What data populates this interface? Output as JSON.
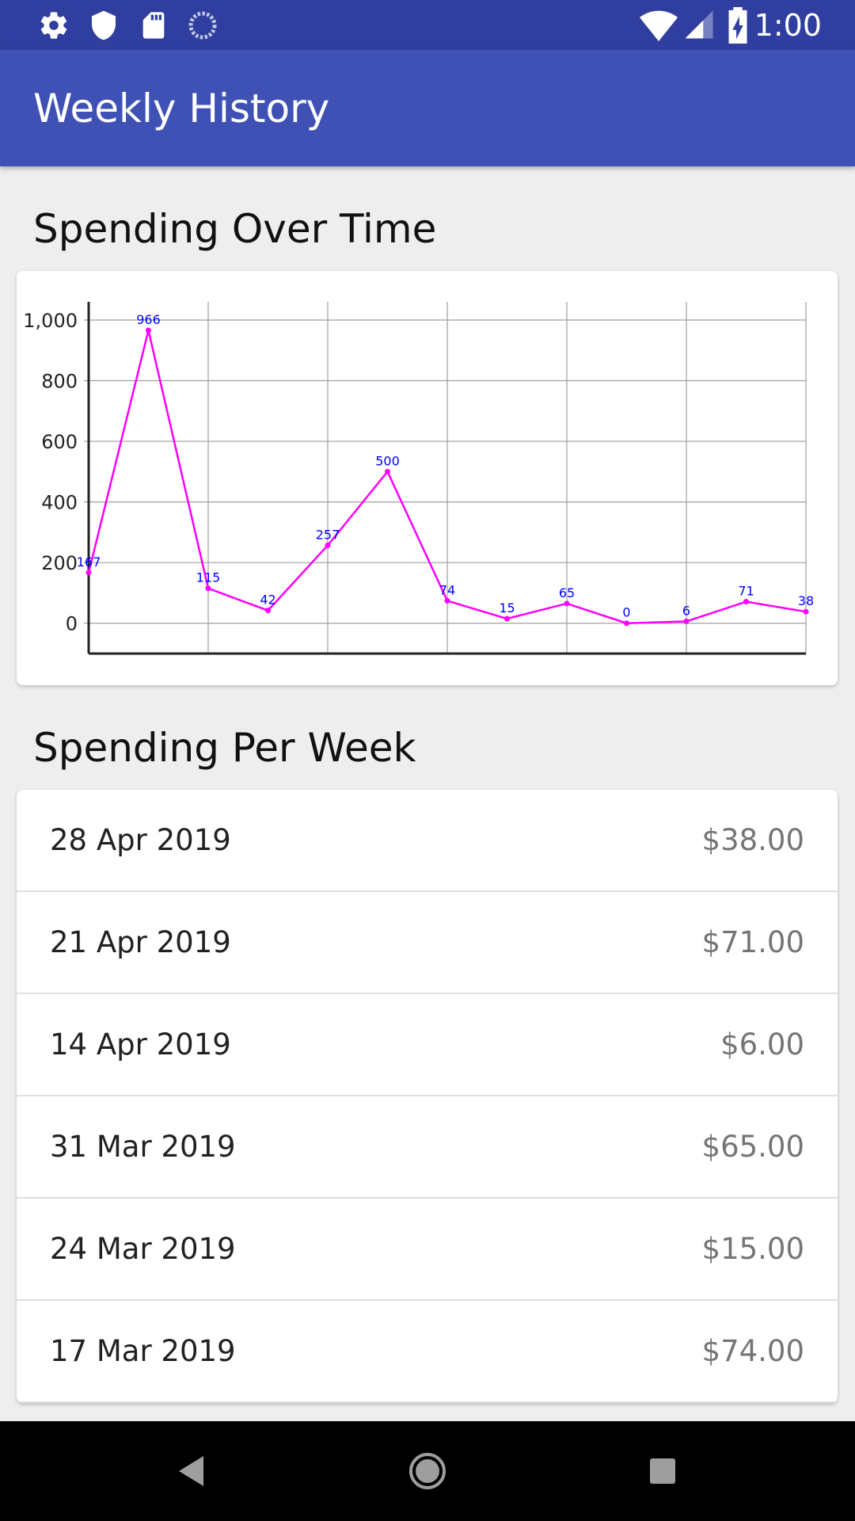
{
  "status_bar": {
    "time": "1:00",
    "icons": [
      "settings-icon",
      "shield-icon",
      "sd-card-icon",
      "sync-icon",
      "wifi-icon",
      "signal-icon",
      "battery-charging-icon"
    ]
  },
  "app_bar": {
    "title": "Weekly History"
  },
  "chart_section": {
    "title": "Spending Over Time"
  },
  "list_section": {
    "title": "Spending Per Week"
  },
  "chart_data": {
    "type": "line",
    "x": [
      0,
      1,
      2,
      3,
      4,
      5,
      6,
      7,
      8,
      9,
      10,
      11,
      12
    ],
    "values": [
      167,
      966,
      115,
      42,
      257,
      500,
      74,
      15,
      65,
      0,
      6,
      71,
      38
    ],
    "point_labels": [
      "167",
      "966",
      "115",
      "42",
      "257",
      "500",
      "74",
      "15",
      "65",
      "0",
      "6",
      "71",
      "38"
    ],
    "y_ticks": [
      0,
      200,
      400,
      600,
      800,
      1000
    ],
    "y_tick_labels": [
      "0",
      "200",
      "400",
      "600",
      "800",
      "1,000"
    ],
    "ylim": [
      -100,
      1060
    ],
    "xlim": [
      0,
      12
    ],
    "grid": true,
    "line_color": "#ff00ff",
    "label_color": "#0000ff"
  },
  "weeks": [
    {
      "date": "28 Apr 2019",
      "amount": "$38.00"
    },
    {
      "date": "21 Apr 2019",
      "amount": "$71.00"
    },
    {
      "date": "14 Apr 2019",
      "amount": "$6.00"
    },
    {
      "date": "31 Mar 2019",
      "amount": "$65.00"
    },
    {
      "date": "24 Mar 2019",
      "amount": "$15.00"
    },
    {
      "date": "17 Mar 2019",
      "amount": "$74.00"
    }
  ],
  "nav_bar": {
    "buttons": [
      "back-icon",
      "home-icon",
      "recents-icon"
    ]
  }
}
